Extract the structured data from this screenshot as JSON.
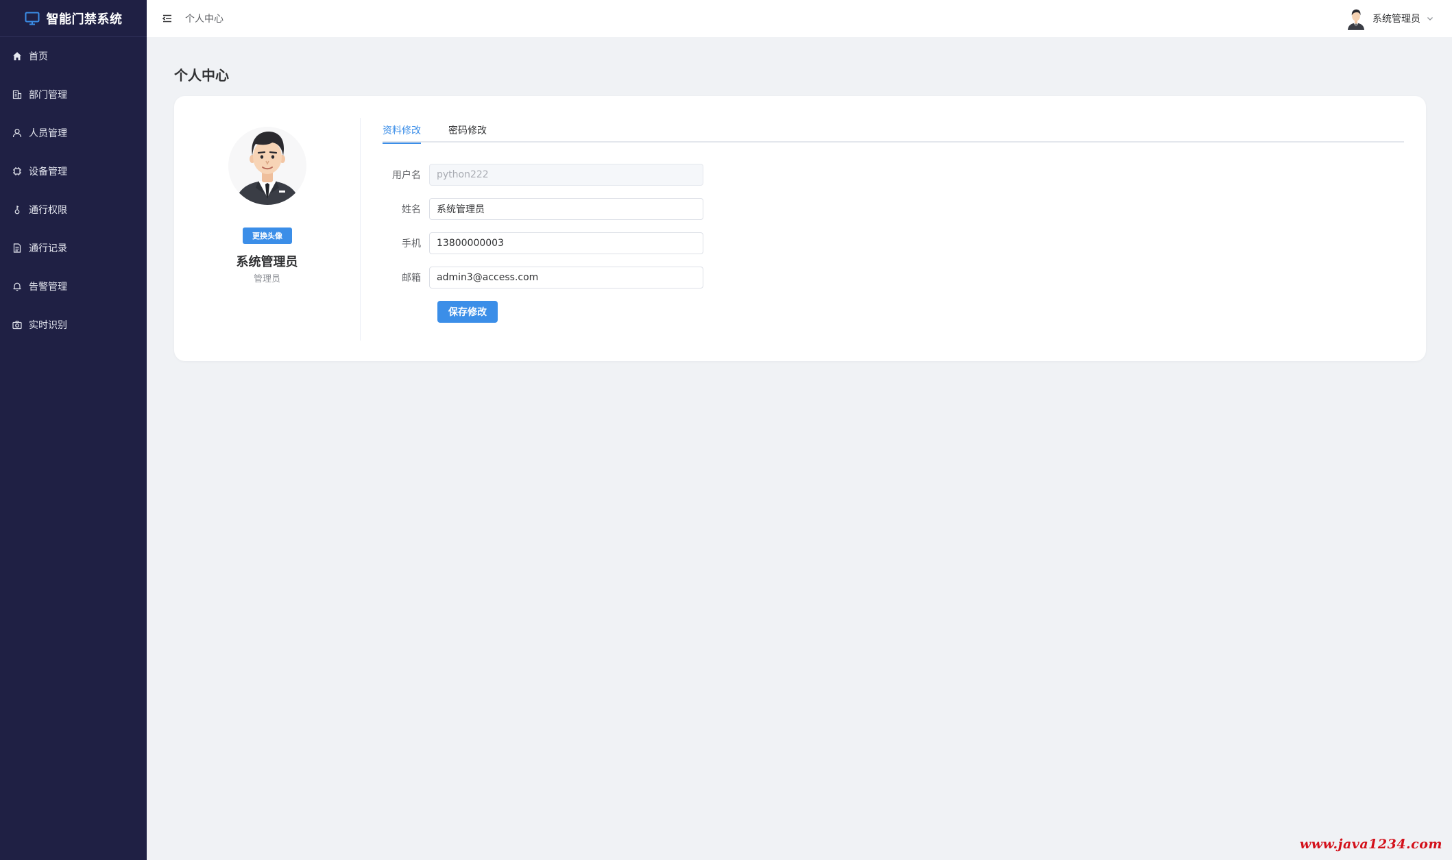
{
  "app": {
    "title": "智能门禁系统"
  },
  "sidebar": {
    "items": [
      {
        "label": "首页",
        "icon": "home-icon"
      },
      {
        "label": "部门管理",
        "icon": "building-icon"
      },
      {
        "label": "人员管理",
        "icon": "user-icon"
      },
      {
        "label": "设备管理",
        "icon": "chip-icon"
      },
      {
        "label": "通行权限",
        "icon": "key-icon"
      },
      {
        "label": "通行记录",
        "icon": "document-icon"
      },
      {
        "label": "告警管理",
        "icon": "bell-icon"
      },
      {
        "label": "实时识别",
        "icon": "camera-icon"
      }
    ]
  },
  "header": {
    "breadcrumb": "个人中心",
    "user_name": "系统管理员"
  },
  "page": {
    "title": "个人中心"
  },
  "profile": {
    "change_avatar_label": "更换头像",
    "name": "系统管理员",
    "role": "管理员"
  },
  "tabs": [
    {
      "label": "资料修改",
      "active": true
    },
    {
      "label": "密码修改",
      "active": false
    }
  ],
  "form": {
    "username": {
      "label": "用户名",
      "value": "python222",
      "disabled": true
    },
    "realname": {
      "label": "姓名",
      "value": "系统管理员"
    },
    "phone": {
      "label": "手机",
      "value": "13800000003"
    },
    "email": {
      "label": "邮箱",
      "value": "admin3@access.com"
    },
    "save_label": "保存修改"
  },
  "watermark": "www.java1234.com",
  "colors": {
    "sidebar_bg": "#1f2044",
    "accent": "#3b8ee8",
    "page_bg": "#f0f2f5",
    "watermark": "#d3101a"
  }
}
